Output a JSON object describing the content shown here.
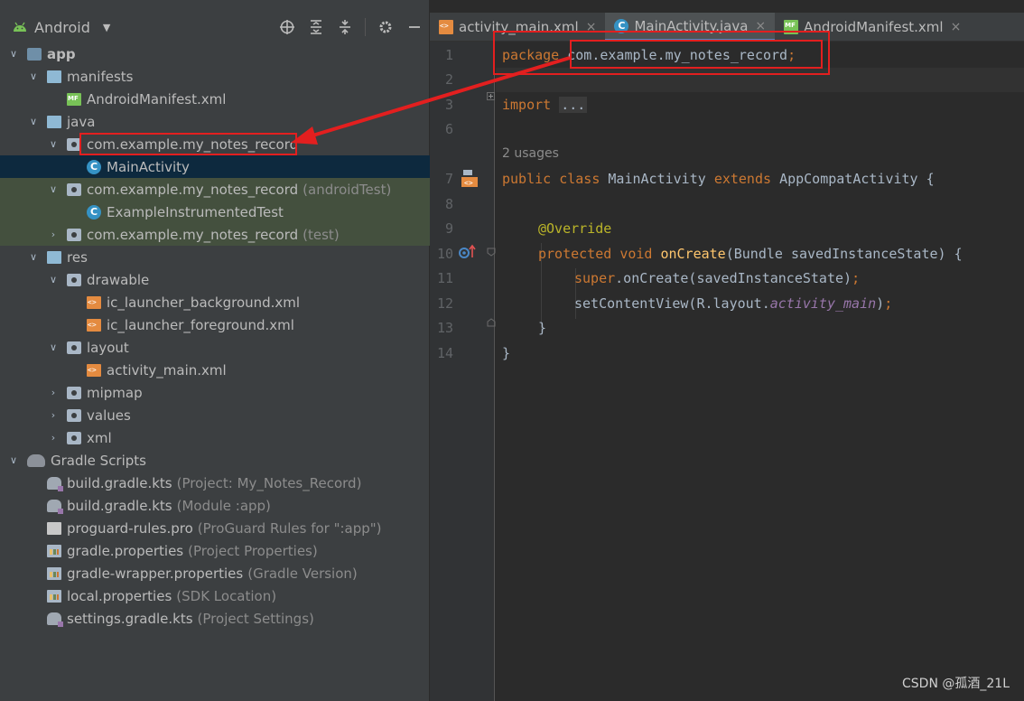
{
  "panel": {
    "title": "Android",
    "dropdown_icon": "chevron-down",
    "tools": [
      "locate-icon",
      "expand-all-icon",
      "collapse-all-icon",
      "gear-icon",
      "minimize-icon"
    ]
  },
  "tree": [
    {
      "label": "app",
      "hint": "",
      "icon": "module",
      "chev": "v"
    },
    {
      "label": "manifests",
      "hint": "",
      "icon": "folder",
      "chev": "v"
    },
    {
      "label": "AndroidManifest.xml",
      "hint": "",
      "icon": "manifest",
      "chev": ""
    },
    {
      "label": "java",
      "hint": "",
      "icon": "folder",
      "chev": "v"
    },
    {
      "label": "com.example.my_notes_record",
      "hint": "",
      "icon": "package",
      "chev": "v"
    },
    {
      "label": "MainActivity",
      "hint": "",
      "icon": "class",
      "chev": ""
    },
    {
      "label": "com.example.my_notes_record",
      "hint": "(androidTest)",
      "icon": "package",
      "chev": "v"
    },
    {
      "label": "ExampleInstrumentedTest",
      "hint": "",
      "icon": "class",
      "chev": ""
    },
    {
      "label": "com.example.my_notes_record",
      "hint": "(test)",
      "icon": "package",
      "chev": ">"
    },
    {
      "label": "res",
      "hint": "",
      "icon": "folder",
      "chev": "v"
    },
    {
      "label": "drawable",
      "hint": "",
      "icon": "package",
      "chev": "v"
    },
    {
      "label": "ic_launcher_background.xml",
      "hint": "",
      "icon": "xml",
      "chev": ""
    },
    {
      "label": "ic_launcher_foreground.xml",
      "hint": "",
      "icon": "xml",
      "chev": ""
    },
    {
      "label": "layout",
      "hint": "",
      "icon": "package",
      "chev": "v"
    },
    {
      "label": "activity_main.xml",
      "hint": "",
      "icon": "xml",
      "chev": ""
    },
    {
      "label": "mipmap",
      "hint": "",
      "icon": "package",
      "chev": ">"
    },
    {
      "label": "values",
      "hint": "",
      "icon": "package",
      "chev": ">"
    },
    {
      "label": "xml",
      "hint": "",
      "icon": "package",
      "chev": ">"
    },
    {
      "label": "Gradle Scripts",
      "hint": "",
      "icon": "gradle-scripts",
      "chev": "v"
    },
    {
      "label": "build.gradle.kts",
      "hint": "(Project: My_Notes_Record)",
      "icon": "gradle",
      "chev": ""
    },
    {
      "label": "build.gradle.kts",
      "hint": "(Module :app)",
      "icon": "gradle",
      "chev": ""
    },
    {
      "label": "proguard-rules.pro",
      "hint": "(ProGuard Rules for \":app\")",
      "icon": "pro",
      "chev": ""
    },
    {
      "label": "gradle.properties",
      "hint": "(Project Properties)",
      "icon": "props",
      "chev": ""
    },
    {
      "label": "gradle-wrapper.properties",
      "hint": "(Gradle Version)",
      "icon": "props",
      "chev": ""
    },
    {
      "label": "local.properties",
      "hint": "(SDK Location)",
      "icon": "props",
      "chev": ""
    },
    {
      "label": "settings.gradle.kts",
      "hint": "(Project Settings)",
      "icon": "gradle",
      "chev": ""
    }
  ],
  "tabs": [
    {
      "label": "activity_main.xml",
      "icon": "xml",
      "close": "×"
    },
    {
      "label": "MainActivity.java",
      "icon": "class",
      "close": "×"
    },
    {
      "label": "AndroidManifest.xml",
      "icon": "manifest",
      "close": "×"
    }
  ],
  "editor": {
    "line_numbers": [
      "1",
      "2",
      "3",
      "6",
      "7",
      "8",
      "9",
      "10",
      "11",
      "12",
      "13",
      "14"
    ],
    "usages": "2 usages",
    "tokens": {
      "package_kw": "package",
      "package_name": "com.example.my_notes_record",
      "semicolon": ";",
      "import_kw": "import",
      "import_fold": "...",
      "public_kw": "public",
      "class_kw": "class",
      "class_name": "MainActivity",
      "extends_kw": "extends",
      "super_class": "AppCompatActivity {",
      "override": "@Override",
      "protected_kw": "protected",
      "void_kw": "void",
      "method_name": "onCreate",
      "params": "(Bundle savedInstanceState) {",
      "super_kw": "super",
      "super_call": ".onCreate(savedInstanceState)",
      "set_content": "setContentView(R.layout.",
      "layout_field": "activity_main",
      "close_paren": ")",
      "close_method": "}",
      "close_class": "}"
    }
  },
  "watermark": "CSDN @孤酒_21L",
  "colors": {
    "highlight": "#e31f1f",
    "keyword": "#cc7832",
    "annotation": "#bbb529",
    "method": "#ffc66d",
    "selection": "#0d293e"
  }
}
